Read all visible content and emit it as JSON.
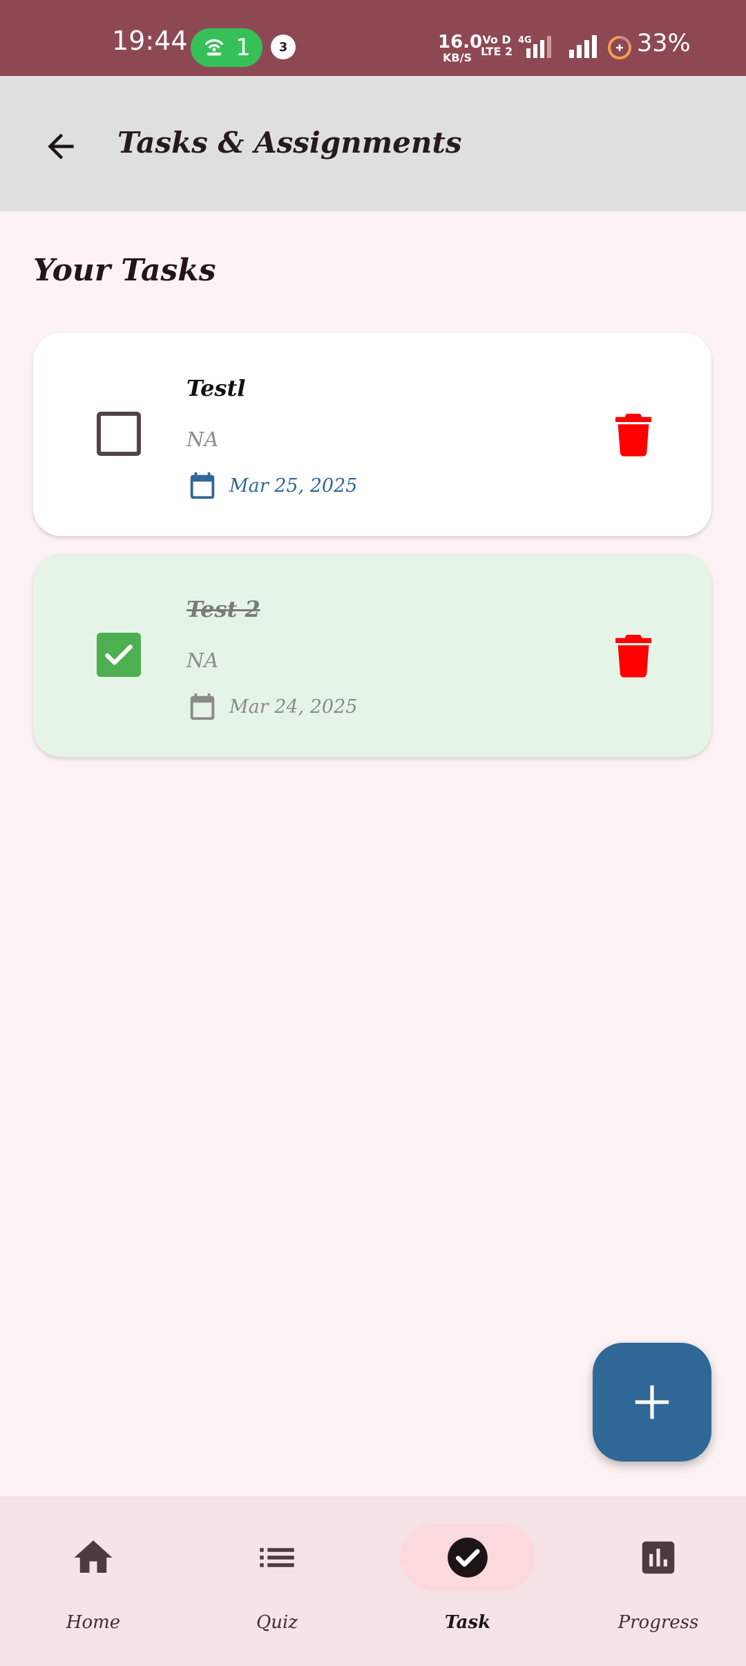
{
  "status_bar": {
    "time": "19:44",
    "hotspot_count": "1",
    "notification_count": "3",
    "net_speed_value": "16.0",
    "net_speed_unit": "KB/S",
    "volte_top": "Vo D",
    "volte_bottom": "LTE 2",
    "network_type": "4G",
    "battery_percent": "33%"
  },
  "app_bar": {
    "title": "Tasks & Assignments"
  },
  "section_title": "Your Tasks",
  "tasks": [
    {
      "name": "Testl",
      "description": "NA",
      "date": "Mar 25, 2025",
      "completed": false
    },
    {
      "name": "Test 2",
      "description": "NA",
      "date": "Mar 24, 2025",
      "completed": true
    }
  ],
  "nav": {
    "items": [
      {
        "label": "Home",
        "icon": "home-icon",
        "active": false
      },
      {
        "label": "Quiz",
        "icon": "list-icon",
        "active": false
      },
      {
        "label": "Task",
        "icon": "check-circle-icon",
        "active": true
      },
      {
        "label": "Progress",
        "icon": "bar-chart-icon",
        "active": false
      }
    ]
  },
  "colors": {
    "status_bar": "#8e4853",
    "app_bar": "#dfdfdf",
    "background": "#fdf3f4",
    "primary": "#2f6796",
    "completed_card": "#e6f4e7",
    "checkbox_checked": "#4caf50",
    "delete": "#ff0000",
    "nav_background": "#f6e3e5",
    "nav_active_pill": "#fcd9dc"
  },
  "fab_icon": "plus-icon"
}
